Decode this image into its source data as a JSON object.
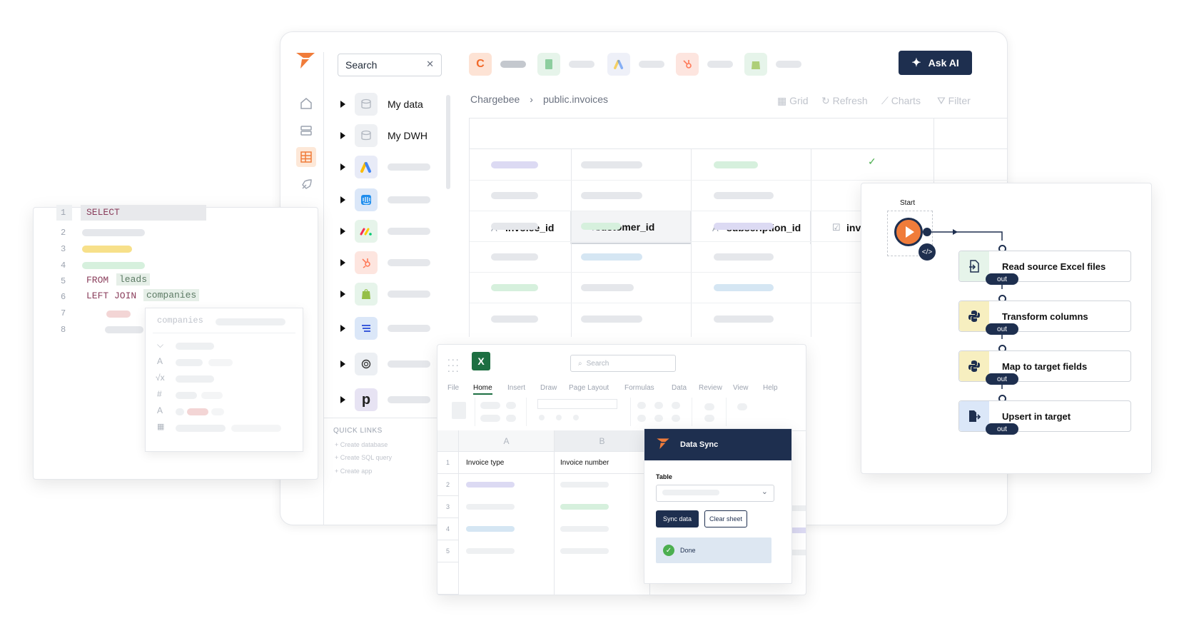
{
  "main": {
    "search": {
      "label": "Search"
    },
    "tree": [
      {
        "label": "My data"
      },
      {
        "label": "My DWH"
      }
    ],
    "breadcrumb": {
      "source": "Chargebee",
      "table": "public.invoices"
    },
    "toolbar": {
      "grid": "Grid",
      "refresh": "Refresh",
      "charts": "Charts",
      "filter": "Filter"
    },
    "ask_ai": "Ask AI",
    "columns": [
      "invoice_id",
      "customer_id",
      "subscription_id",
      "invoice_recurring"
    ],
    "quick_links": {
      "title": "QUICK LINKS",
      "items": [
        "Create database",
        "Create SQL query",
        "Create app"
      ]
    }
  },
  "editor": {
    "line_numbers": [
      "1",
      "2",
      "3",
      "4",
      "5",
      "6",
      "7",
      "8"
    ],
    "select": "SELECT",
    "from_kw": "FROM",
    "from_table": "leads",
    "join_kw": "LEFT JOIN",
    "join_table": "companies",
    "popup_title": "companies"
  },
  "flow": {
    "start": "Start",
    "nodes": [
      "Read source Excel files",
      "Transform columns",
      "Map to target fields",
      "Upsert in target"
    ],
    "out_label": "out"
  },
  "excel": {
    "search": "Search",
    "tabs": [
      "File",
      "Home",
      "Insert",
      "Draw",
      "Page Layout",
      "Formulas",
      "Data",
      "Review",
      "View",
      "Help"
    ],
    "col_headers": [
      "A",
      "B"
    ],
    "rows": [
      "1",
      "2",
      "3",
      "4",
      "5"
    ],
    "headers": [
      "Invoice type",
      "Invoice number"
    ]
  },
  "sync": {
    "title": "Data Sync",
    "table_label": "Table",
    "sync_btn": "Sync data",
    "clear_btn": "Clear sheet",
    "done": "Done"
  },
  "colors": {
    "navy": "#1e2f4f",
    "orange": "#f07c3a",
    "accent_bg": "#fde8d8"
  }
}
